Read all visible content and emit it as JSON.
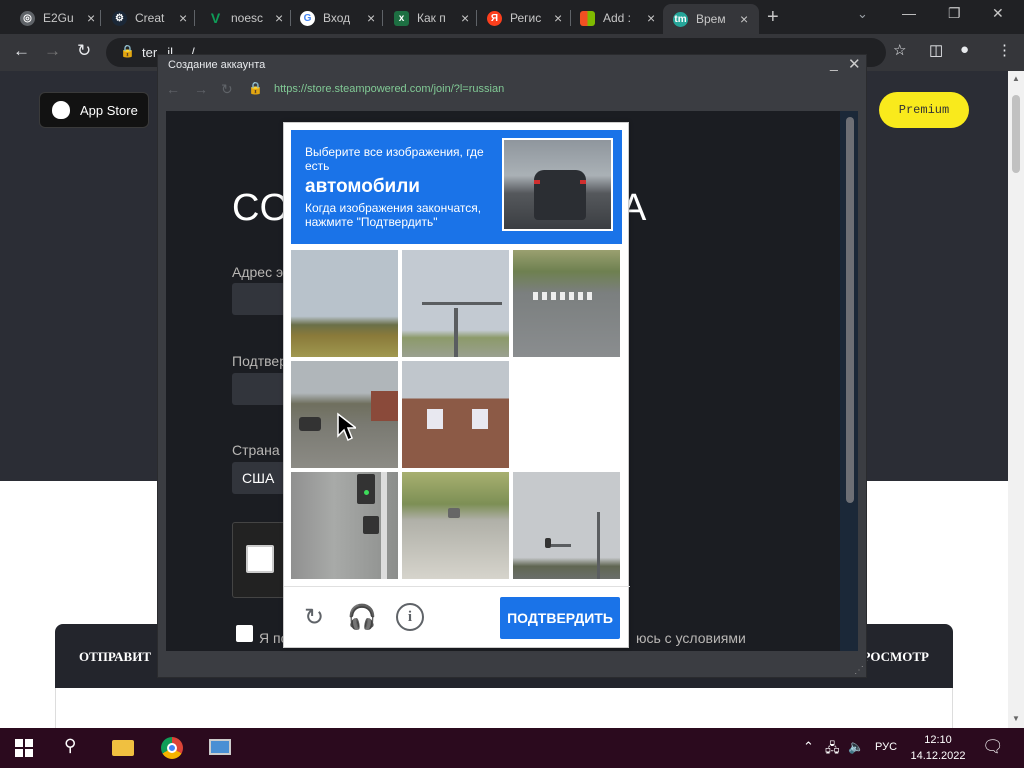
{
  "browser": {
    "tabs": [
      {
        "label": "E2Gu",
        "icon": "globe-icon",
        "color": "#5f6368"
      },
      {
        "label": "Creat",
        "icon": "steam-icon",
        "color": "#1b2838"
      },
      {
        "label": "noesc",
        "icon": "v-icon",
        "color": "#0f9d58"
      },
      {
        "label": "Вход",
        "icon": "google-icon",
        "color": "#ffffff"
      },
      {
        "label": "Как п",
        "icon": "excel-icon",
        "color": "#1d6f42"
      },
      {
        "label": "Регис",
        "icon": "yandex-icon",
        "color": "#fc3f1d"
      },
      {
        "label": "Add :",
        "icon": "microsoft-icon",
        "color": "#f25022"
      },
      {
        "label": "Врем",
        "icon": "temp-mail-icon",
        "color": "#26a69a"
      }
    ],
    "url": "ter...il...../"
  },
  "page": {
    "app_store": "App Store",
    "premium": "Premium",
    "bottom_left": "ОТПРАВИТ",
    "bottom_right": "РОСМОТР"
  },
  "popup": {
    "title": "Создание аккаунта",
    "url": "https://store.steampowered.com/join/?l=russian",
    "heading_left": "СО",
    "heading_right": "А",
    "label_email": "Адрес э",
    "label_confirm": "Подтвер",
    "label_country": "Страна",
    "country_value": "США",
    "agree_left": "Я по",
    "agree_right": "юсь с условиями"
  },
  "captcha": {
    "instruction_top": "Выберите все изображения, где есть",
    "target": "автомобили",
    "instruction_bottom": "Когда изображения закончатся, нажмите \"Подтвердить\"",
    "verify_label": "ПОДТВЕРДИТЬ",
    "tiles": [
      {
        "name": "tile-field-horizon",
        "content": "field"
      },
      {
        "name": "tile-traffic-light-pole",
        "content": "pole"
      },
      {
        "name": "tile-road-crosswalk",
        "content": "road"
      },
      {
        "name": "tile-street-cars",
        "content": "street"
      },
      {
        "name": "tile-brick-house",
        "content": "house"
      },
      {
        "name": "tile-empty",
        "content": "empty"
      },
      {
        "name": "tile-traffic-signal-closeup",
        "content": "signal"
      },
      {
        "name": "tile-rural-road-car",
        "content": "rural"
      },
      {
        "name": "tile-street-lamp",
        "content": "lamp"
      }
    ]
  },
  "taskbar": {
    "language": "РУС",
    "time": "12:10",
    "date": "14.12.2022"
  }
}
